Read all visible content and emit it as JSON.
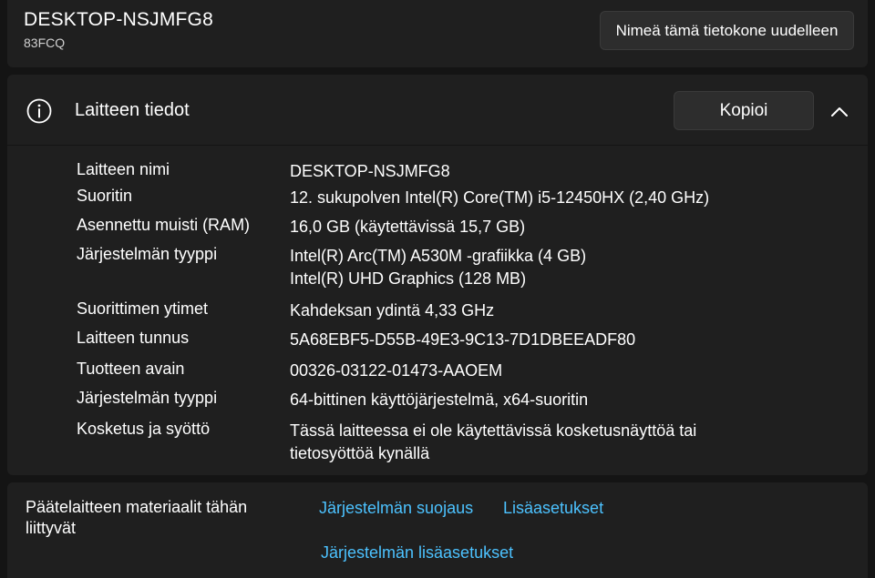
{
  "device": {
    "name": "DESKTOP-NSJMFG8",
    "model": "83FCQ",
    "rename_label": "Nimeä tämä tietokone uudelleen"
  },
  "specs": {
    "title": "Laitteen tiedot",
    "copy_label": "Kopioi",
    "info_icon": "info-icon",
    "collapse_icon": "chevron-up-icon",
    "rows": [
      {
        "label": "Laitteen nimi",
        "value": "DESKTOP-NSJMFG8"
      },
      {
        "label": "Suoritin",
        "value": "12. sukupolven Intel(R) Core(TM) i5-12450HX   (2,40 GHz)"
      },
      {
        "label": "Asennettu muisti (RAM)",
        "value": "16,0 GB (käytettävissä 15,7 GB)"
      },
      {
        "label": "Järjestelmän tyyppi",
        "value": "Intel(R) Arc(TM) A530M -grafiikka (4 GB)",
        "value2": "Intel(R) UHD Graphics (128 MB)"
      },
      {
        "label": "Suorittimen ytimet",
        "value": "Kahdeksan ydintä  4,33 GHz"
      },
      {
        "label": "Laitteen tunnus",
        "value": "5A68EBF5-D55B-49E3-9C13-7D1DBEEADF80"
      },
      {
        "label": "Tuotteen avain",
        "value": "00326-03122-01473-AAOEM"
      },
      {
        "label": "Järjestelmän tyyppi",
        "value": "64-bittinen käyttöjärjestelmä, x64-suoritin"
      },
      {
        "label": "Kosketus ja syöttö",
        "value": "Tässä laitteessa ei ole käytettävissä kosketusnäyttöä tai",
        "value2": "tietosyöttöä kynällä"
      }
    ]
  },
  "related": {
    "title_line1": "Päätelaitteen materiaalit tähän",
    "title_line2": "liittyvät",
    "links": [
      "Järjestelmän suojaus",
      "Lisäasetukset",
      "Järjestelmän lisäasetukset"
    ]
  },
  "colors": {
    "background": "#141414",
    "card": "#1f1f1f",
    "button": "#2d2d2d",
    "link": "#4cc2ff",
    "text": "#ffffff"
  }
}
